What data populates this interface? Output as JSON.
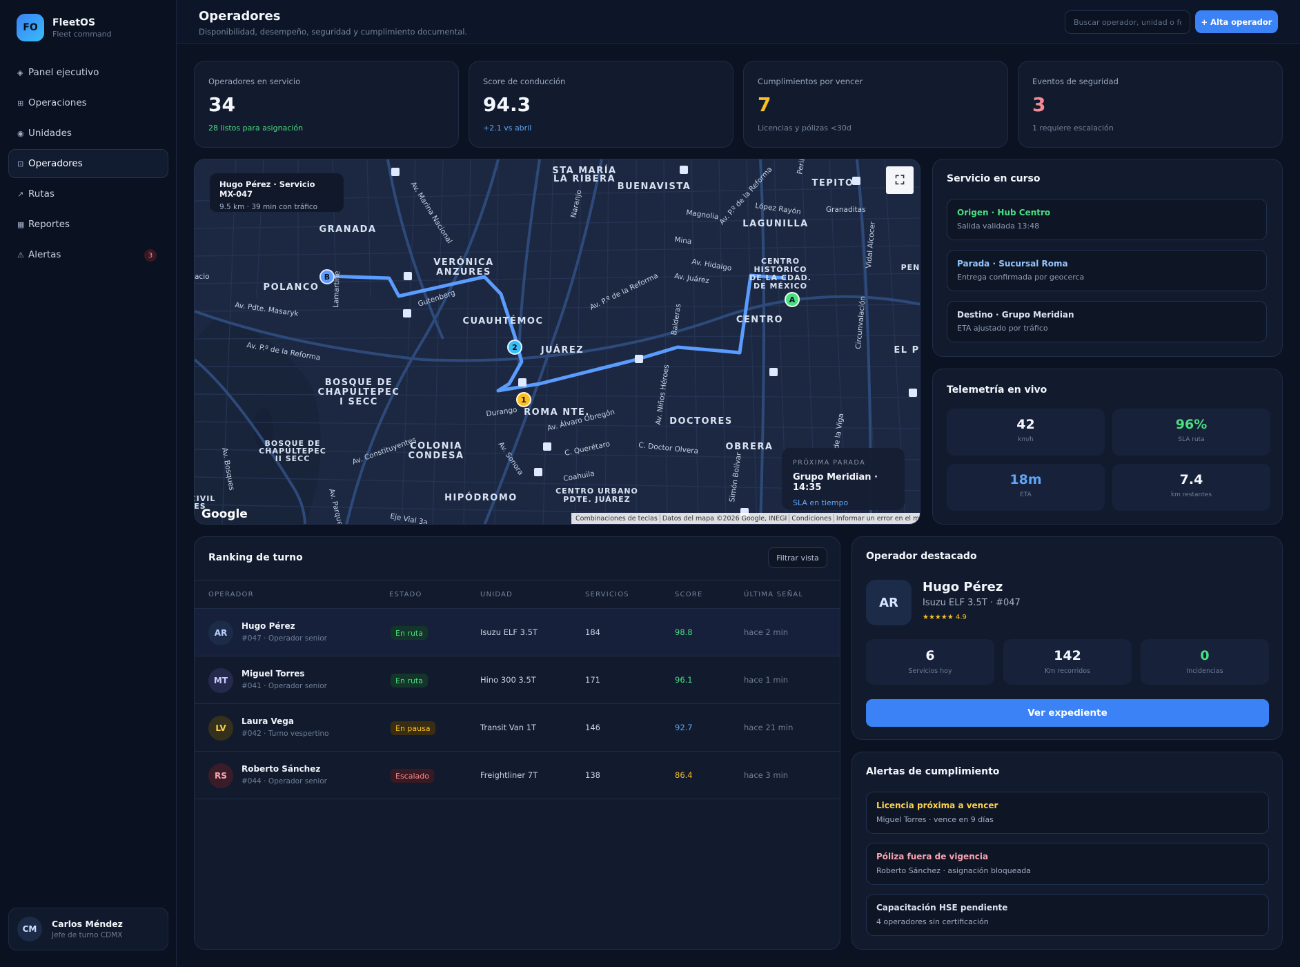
{
  "brand": {
    "initials": "FO",
    "name": "FleetOS",
    "subtitle": "Fleet command"
  },
  "nav": [
    {
      "icon": "◈",
      "label": "Panel ejecutivo"
    },
    {
      "icon": "⊞",
      "label": "Operaciones"
    },
    {
      "icon": "◉",
      "label": "Unidades"
    },
    {
      "icon": "⊡",
      "label": "Operadores",
      "active": true
    },
    {
      "icon": "↗",
      "label": "Rutas"
    },
    {
      "icon": "▦",
      "label": "Reportes"
    },
    {
      "icon": "⚠",
      "label": "Alertas",
      "badge": "3"
    }
  ],
  "user": {
    "initials": "CM",
    "name": "Carlos Méndez",
    "role": "Jefe de turno CDMX"
  },
  "header": {
    "title": "Operadores",
    "subtitle": "Disponibilidad, desempeño, seguridad y cumplimiento documental.",
    "search_placeholder": "Buscar operador, unidad o fo",
    "add_label": "+ Alta operador"
  },
  "kpis": [
    {
      "label": "Operadores en servicio",
      "value": "34",
      "note": "28 listos para asignación",
      "value_color": "#f4f7fc",
      "note_color": "#4ade80"
    },
    {
      "label": "Score de conducción",
      "value": "94.3",
      "note": "+2.1 vs abril",
      "value_color": "#f4f7fc",
      "note_color": "#60a5fa"
    },
    {
      "label": "Cumplimientos por vencer",
      "value": "7",
      "note": "Licencias y pólizas <30d",
      "value_color": "#fbbf24",
      "note_color": "#74839c"
    },
    {
      "label": "Eventos de seguridad",
      "value": "3",
      "note": "1 requiere escalación",
      "value_color": "#f28b96",
      "note_color": "#74839c"
    }
  ],
  "map": {
    "info_title": "Hugo Pérez · Servicio MX-047",
    "info_sub": "9.5 km · 39 min con tráfico",
    "next_stop_label": "PRÓXIMA PARADA",
    "next_stop_value": "Grupo Meridian · 14:35",
    "next_stop_sla": "SLA en tiempo",
    "google": "Google",
    "attribution": [
      "Combinaciones de teclas",
      "Datos del mapa ©2026 Google, INEGI",
      "Condiciones",
      "Informar un error en el mapa"
    ],
    "markers": {
      "a": "A",
      "b": "B",
      "one": "1",
      "two": "2"
    },
    "labels": {
      "granada": "GRANADA",
      "polanco": "POLANCO",
      "veronica1": "VERÓNICA",
      "veronica2": "ANZURES",
      "cuauhtemoc": "CUAUHTÉMOC",
      "juarez": "JUÁREZ",
      "bosque1": "BOSQUE DE",
      "bosque2": "CHAPULTEPEC",
      "bosque3": "I SECC",
      "bosqueb1": "BOSQUE DE",
      "bosqueb2": "CHAPULTEPEC",
      "bosqueb3": "II SECC",
      "roma": "ROMA NTE.",
      "condesa1": "COLONIA",
      "condesa2": "CONDESA",
      "hipodromo": "HIPÓDROMO",
      "doctores": "DOCTORES",
      "obrera": "OBRERA",
      "centro": "CENTRO",
      "historico1": "CENTRO",
      "historico2": "HISTÓRICO",
      "historico3": "DE LA CDAD.",
      "historico4": "DE MÉXICO",
      "buenavista": "BUENAVISTA",
      "stamaria1": "STA MARÍA",
      "stamaria2": "LA RIBERA",
      "tepito": "TEPITO",
      "lagunilla": "LAGUNILLA",
      "urbano1": "CENTRO URBANO",
      "urbano2": "PDTE. JUÁREZ",
      "elpaso": "EL P",
      "peni": "PENI",
      "masaryk": "Av. Pdte. Masaryk",
      "reforma_w": "Av. P.º de la Reforma",
      "reforma_c": "Av. P.º de la Reforma",
      "reforma_n": "Av. P.º de la Reforma",
      "juarez_av": "Av. Juárez",
      "hidalgo": "Av. Hidalgo",
      "magnolia": "Magnolia",
      "mina": "Mina",
      "lopez": "López Rayón",
      "granaditas": "Granaditas",
      "durango": "Durango",
      "obregon": "Av. Álvaro Obregón",
      "queretaro": "C. Querétaro",
      "coahuila": "Coahuila",
      "olvera": "C. Doctor Olvera",
      "constituyentes": "Av. Constituyentes",
      "sonora": "Av. Sonora",
      "balderas": "Balderas",
      "ninos": "Av. Niños Héroes",
      "bolivar": "Simón Bolívar",
      "circunvalacion": "Circunvalación",
      "alcocer": "Vidal Alcocer",
      "marina": "Av. Marina Nacional",
      "naranjo": "Naranjo",
      "lamartine": "Lamartine",
      "gutenberg": "Gutenberg",
      "bosques": "Av. Bosques",
      "parque": "Av. Parque",
      "ejevial": "Eje Vial 3a",
      "dvia": "de la Viga",
      "civil1": "CIVIL",
      "civil2": "ES",
      "acio": "acio",
      "perib": "Perib"
    }
  },
  "service": {
    "title": "Servicio en curso",
    "stops": [
      {
        "title": "Origen · Hub Centro",
        "sub": "Salida validada 13:48",
        "color": "#4ade80"
      },
      {
        "title": "Parada · Sucursal Roma",
        "sub": "Entrega confirmada por geocerca",
        "color": "#93c5fd"
      },
      {
        "title": "Destino · Grupo Meridian",
        "sub": "ETA ajustado por tráfico",
        "color": "#dbe4f2"
      }
    ]
  },
  "telemetry": {
    "title": "Telemetría en vivo",
    "items": [
      {
        "value": "42",
        "unit": "km/h",
        "color": "#f4f7fc"
      },
      {
        "value": "96%",
        "unit": "SLA ruta",
        "color": "#4ade80"
      },
      {
        "value": "18m",
        "unit": "ETA",
        "color": "#60a5fa"
      },
      {
        "value": "7.4",
        "unit": "km restantes",
        "color": "#f4f7fc"
      }
    ]
  },
  "ranking": {
    "title": "Ranking de turno",
    "filter_label": "Filtrar vista",
    "columns": [
      "OPERADOR",
      "ESTADO",
      "UNIDAD",
      "SERVICIOS",
      "SCORE",
      "ÚLTIMA SEÑAL"
    ],
    "rows": [
      {
        "initials": "AR",
        "name": "Hugo Pérez",
        "sub": "#047 · Operador senior",
        "status": "En ruta",
        "unit": "Isuzu ELF 3.5T",
        "services": "184",
        "score": "98.8",
        "signal": "hace 2 min",
        "avatar_bg": "#1c2b48",
        "avatar_fg": "#bcd3ff",
        "pill_bg": "#14352a",
        "pill_fg": "#4ade80",
        "score_color": "#4ade80",
        "highlight": true
      },
      {
        "initials": "MT",
        "name": "Miguel Torres",
        "sub": "#041 · Operador senior",
        "status": "En ruta",
        "unit": "Hino 300 3.5T",
        "services": "171",
        "score": "96.1",
        "signal": "hace 1 min",
        "avatar_bg": "#252a4d",
        "avatar_fg": "#c7ccff",
        "pill_bg": "#14352a",
        "pill_fg": "#4ade80",
        "score_color": "#4ade80",
        "highlight": false
      },
      {
        "initials": "LV",
        "name": "Laura Vega",
        "sub": "#042 · Turno vespertino",
        "status": "En pausa",
        "unit": "Transit Van 1T",
        "services": "146",
        "score": "92.7",
        "signal": "hace 21 min",
        "avatar_bg": "#35301c",
        "avatar_fg": "#fcd34d",
        "pill_bg": "#3a2e12",
        "pill_fg": "#fbbf24",
        "score_color": "#60a5fa",
        "highlight": false
      },
      {
        "initials": "RS",
        "name": "Roberto Sánchez",
        "sub": "#044 · Operador senior",
        "status": "Escalado",
        "unit": "Freightliner 7T",
        "services": "138",
        "score": "86.4",
        "signal": "hace 3 min",
        "avatar_bg": "#3a1c28",
        "avatar_fg": "#f8a4b0",
        "pill_bg": "#3a1a22",
        "pill_fg": "#f28b96",
        "score_color": "#fbbf24",
        "highlight": false
      }
    ]
  },
  "featured": {
    "title": "Operador destacado",
    "initials": "AR",
    "name": "Hugo Pérez",
    "unit": "Isuzu ELF 3.5T · #047",
    "rating": "★★★★★ 4.9",
    "stats": [
      {
        "value": "6",
        "label": "Servicios hoy",
        "color": "#f4f7fc"
      },
      {
        "value": "142",
        "label": "Km recorridos",
        "color": "#f4f7fc"
      },
      {
        "value": "0",
        "label": "Incidencias",
        "color": "#4ade80"
      }
    ],
    "cta": "Ver expediente"
  },
  "compliance": {
    "title": "Alertas de cumplimiento",
    "items": [
      {
        "title": "Licencia próxima a vencer",
        "sub": "Miguel Torres · vence en 9 días",
        "color": "#fcd34d"
      },
      {
        "title": "Póliza fuera de vigencia",
        "sub": "Roberto Sánchez · asignación bloqueada",
        "color": "#f8a4b0"
      },
      {
        "title": "Capacitación HSE pendiente",
        "sub": "4 operadores sin certificación",
        "color": "#dbe4f2"
      }
    ]
  }
}
